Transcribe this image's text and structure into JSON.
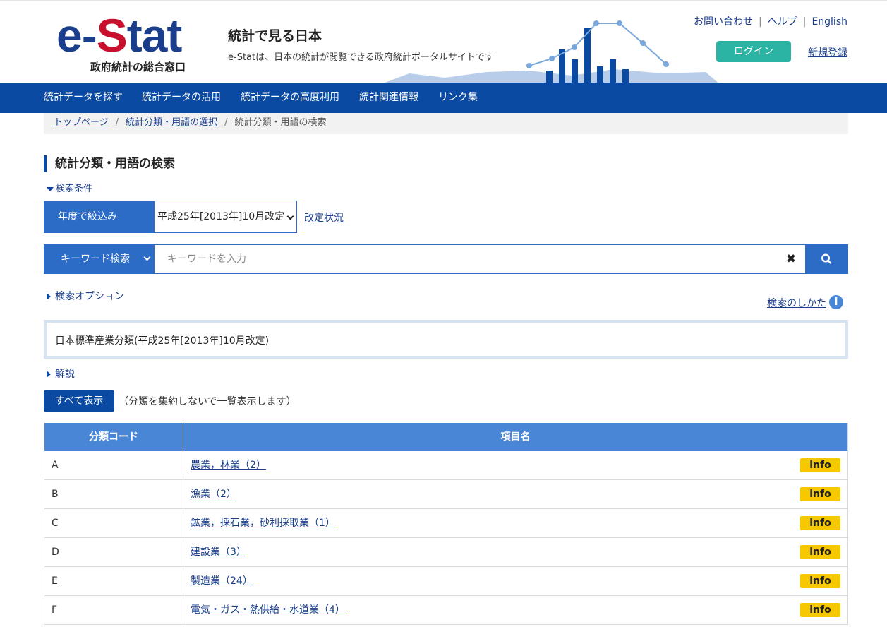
{
  "header": {
    "logo_main_e": "e-",
    "logo_main_s": "S",
    "logo_main_rest": "tat",
    "logo_sub": "政府統計の総合窓口",
    "site_title": "統計で見る日本",
    "site_desc": "e-Statは、日本の統計が閲覧できる政府統計ポータルサイトです",
    "links": [
      "お問い合わせ",
      "ヘルプ",
      "English"
    ],
    "separator": "|",
    "login": "ログイン",
    "register": "新規登録"
  },
  "nav": {
    "items": [
      "統計データを探す",
      "統計データの活用",
      "統計データの高度利用",
      "統計関連情報",
      "リンク集"
    ]
  },
  "breadcrumb": {
    "items": [
      "トップページ",
      "統計分類・用語の選択"
    ],
    "current": "統計分類・用語の検索",
    "separator": "/"
  },
  "page": {
    "title": "統計分類・用語の検索",
    "conditions_toggle": "検索条件",
    "year_filter_label": "年度で絞込み",
    "year_selected": "平成25年[2013年]10月改定",
    "revision_link": "改定状況",
    "keyword_type": "キーワード検索",
    "keyword_placeholder": "キーワードを入力",
    "clear_glyph": "✖",
    "search_options": "検索オプション",
    "how_to_search": "検索のしかた",
    "info_glyph": "i",
    "classification_name": "日本標準産業分類(平成25年[2013年]10月改定)",
    "commentary": "解説",
    "show_all_button": "すべて表示",
    "show_all_note": "（分類を集約しないで一覧表示します）"
  },
  "table": {
    "headers": [
      "分類コード",
      "項目名"
    ],
    "info_label": "info",
    "rows": [
      {
        "code": "A",
        "name": "農業，林業（2）"
      },
      {
        "code": "B",
        "name": "漁業（2）"
      },
      {
        "code": "C",
        "name": "鉱業，採石業，砂利採取業（1）"
      },
      {
        "code": "D",
        "name": "建設業（3）"
      },
      {
        "code": "E",
        "name": "製造業（24）"
      },
      {
        "code": "F",
        "name": "電気・ガス・熱供給・水道業（4）"
      }
    ]
  },
  "icons": {
    "search": "magnifier-icon",
    "clear": "close-icon",
    "help": "info-circle-icon"
  },
  "colors": {
    "brand_blue": "#0b4aa2",
    "accent_blue": "#2d6cc6",
    "header_table_blue": "#4a86d6",
    "logo_red": "#c8102e",
    "login_teal": "#2bb3a4",
    "info_badge_yellow": "#f5c800"
  }
}
